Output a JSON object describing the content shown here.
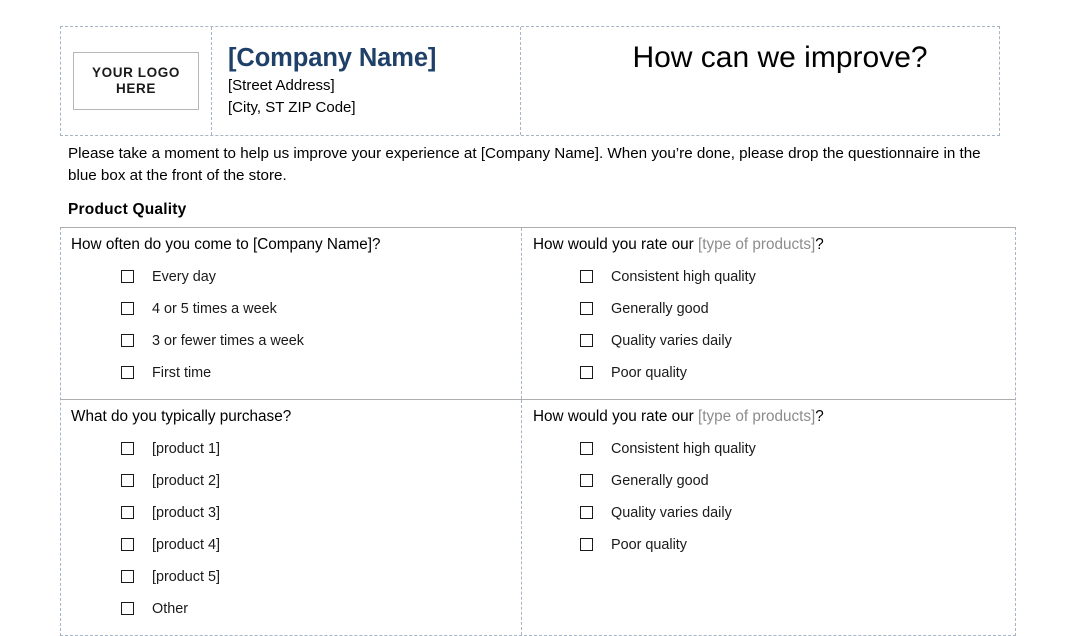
{
  "header": {
    "logo": {
      "line1": "YOUR LOGO",
      "line2": "HERE"
    },
    "company": {
      "name": "[Company Name]",
      "street": "[Street Address]",
      "city_state_zip": "[City, ST  ZIP Code]"
    },
    "title": "How can we improve?"
  },
  "intro": {
    "text": "Please take a moment to help us improve your experience at [Company Name]. When you’re done, please drop the questionnaire in the blue box at the front of the store."
  },
  "section": {
    "heading": "Product  Quality"
  },
  "questions": {
    "q1": {
      "prompt": "How often do you come to [Company Name]?",
      "options": [
        "Every day",
        "4 or 5 times a week",
        "3 or fewer times a week",
        "First time"
      ]
    },
    "q2": {
      "prompt_prefix": "How would you rate our ",
      "prompt_placeholder": "[type of products]",
      "prompt_suffix": "?",
      "options": [
        "Consistent high quality",
        "Generally good",
        "Quality varies daily",
        "Poor quality"
      ]
    },
    "q3": {
      "prompt": "What do you typically purchase?",
      "options": [
        "[product 1]",
        "[product 2]",
        "[product 3]",
        "[product 4]",
        "[product 5]",
        "Other"
      ]
    },
    "q4": {
      "prompt_prefix": "How would you rate our ",
      "prompt_placeholder": "[type of products]",
      "prompt_suffix": "?",
      "options": [
        "Consistent high quality",
        "Generally good",
        "Quality varies daily",
        "Poor quality"
      ]
    }
  },
  "colors": {
    "company_name": "#1f4068",
    "placeholder_gray": "#8c8c8c",
    "border_dashed": "#a6b4c4",
    "border_solid": "#adadad"
  }
}
